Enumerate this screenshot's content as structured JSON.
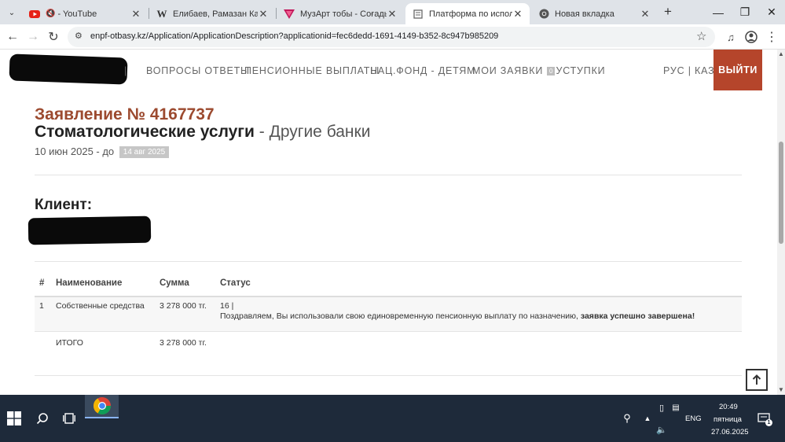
{
  "browser": {
    "tabs": [
      {
        "title": "- YouTube",
        "favicon": "youtube-icon"
      },
      {
        "title": "Елибаев, Рамазан Кабдолд",
        "favicon": "wikipedia-icon"
      },
      {
        "title": "МузАрт тобы - Соғады сен",
        "favicon": "yandex-music-icon"
      },
      {
        "title": "Платформа по использова",
        "favicon": "page-icon"
      },
      {
        "title": "Новая вкладка",
        "favicon": "chrome-icon"
      }
    ],
    "new_tab": "+",
    "url": "enpf-otbasy.kz/Application/ApplicationDescription?applicationid=fec6dedd-1691-4149-b352-8c947b985209"
  },
  "site": {
    "nav": {
      "faq": "ВОПРОСЫ ОТВЕТЫ",
      "pension": "ПЕНСИОННЫЕ ВЫПЛАТЫ",
      "natfund": "НАЦ.ФОНД - ДЕТЯМ",
      "myapps": "МОИ ЗАЯВКИ",
      "services_badge": "0",
      "services": "УСТУПКИ",
      "lang": "РУС | КАЗ",
      "logout": "ВЫЙТИ"
    }
  },
  "application": {
    "title": "Заявление № 4167737",
    "service": "Стоматологические услуги",
    "bank": " - Другие банки",
    "date_from": "10 июн 2025 - до ",
    "date_to": "14 авг 2025",
    "client_label": "Клиент:"
  },
  "table": {
    "headers": [
      "#",
      "Наименование",
      "Сумма",
      "Статус"
    ],
    "rows": [
      {
        "num": "1",
        "name": "Собственные средства",
        "amount": "3 278 000 тг.",
        "status_code": "16 |",
        "status_text": "Поздравляем, Вы использовали свою единовременную пенсионную выплату по назначению, ",
        "status_bold": "заявка успешно завершена!"
      }
    ],
    "total_label": "ИТОГО",
    "total_amount": "3 278 000 тг."
  },
  "taskbar": {
    "lang": "ENG",
    "time": "20:49",
    "day": "пятница",
    "date": "27.06.2025",
    "notifications": "1"
  },
  "colors": {
    "accent": "#b5452b",
    "title": "#9c4a2f",
    "taskbar": "#1e2a3a"
  }
}
